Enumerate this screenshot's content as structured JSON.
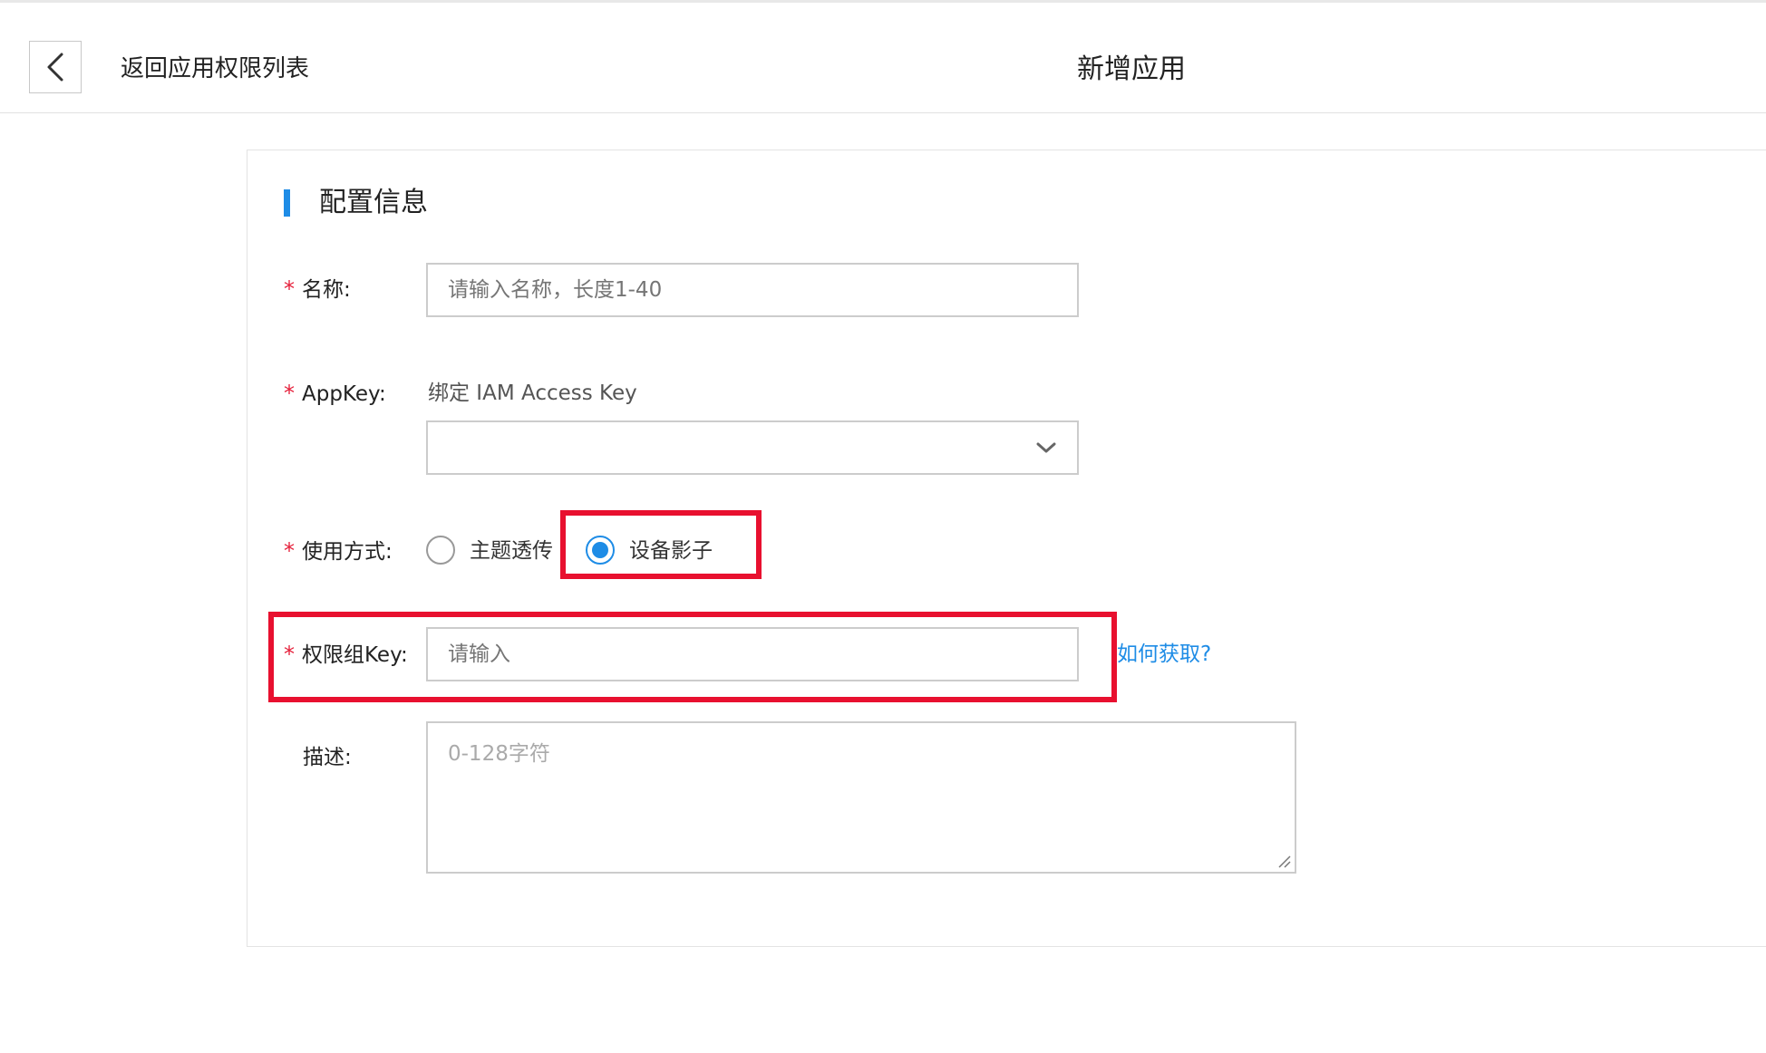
{
  "header": {
    "back_label": "返回应用权限列表",
    "title": "新增应用"
  },
  "section": {
    "title": "配置信息"
  },
  "form": {
    "name": {
      "required_mark": "*",
      "label": "名称:",
      "placeholder": "请输入名称，长度1-40",
      "value": ""
    },
    "appkey": {
      "required_mark": "*",
      "label": "AppKey:",
      "hint": "绑定 IAM Access Key",
      "selected": ""
    },
    "usage": {
      "required_mark": "*",
      "label": "使用方式:",
      "options": [
        {
          "label": "主题透传",
          "checked": false
        },
        {
          "label": "设备影子",
          "checked": true
        }
      ]
    },
    "group_key": {
      "required_mark": "*",
      "label": "权限组Key:",
      "placeholder": "请输入",
      "value": "",
      "help_link": "如何获取?"
    },
    "description": {
      "label": "描述:",
      "placeholder": "0-128字符",
      "value": ""
    }
  },
  "colors": {
    "accent": "#1e8ce6",
    "required": "#e5203b",
    "highlight": "#e8102f"
  },
  "icons": {
    "back": "chevron-left-icon",
    "select": "chevron-down-icon",
    "resize": "resize-grip-icon"
  }
}
